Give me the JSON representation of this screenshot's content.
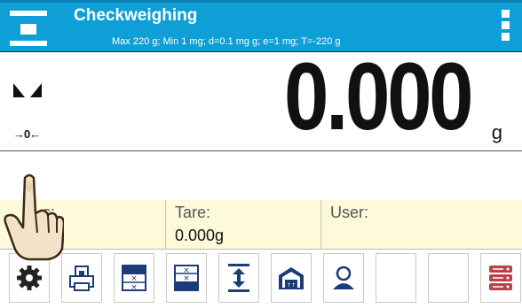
{
  "header": {
    "title": "Checkweighing",
    "subtitle": "Max 220 g; Min 1 mg; d=0.1 mg g; e=1 mg; T=-220 g"
  },
  "display": {
    "reading": "0.000",
    "unit": "g",
    "zero_indicator": "→0←"
  },
  "info": {
    "field1": {
      "label": "Mass:",
      "value": "0.000g",
      "visible_label": "s:",
      "visible_value": "0g"
    },
    "field2": {
      "label": "Tare:",
      "value": "0.000g"
    },
    "field3": {
      "label": "User:",
      "value": ""
    }
  },
  "toolbar": {
    "buttons": [
      {
        "name": "settings-icon"
      },
      {
        "name": "print-icon"
      },
      {
        "name": "threshold-low-icon"
      },
      {
        "name": "threshold-high-icon"
      },
      {
        "name": "range-icon"
      },
      {
        "name": "warehouse-icon"
      },
      {
        "name": "user-icon"
      },
      {
        "name": "empty"
      },
      {
        "name": "empty"
      },
      {
        "name": "database-icon"
      }
    ]
  },
  "colors": {
    "header_bg": "#0f9fd7",
    "info_bg": "#fdfad9",
    "accent_red": "#b8444a",
    "icon_blue": "#1a3c78"
  }
}
